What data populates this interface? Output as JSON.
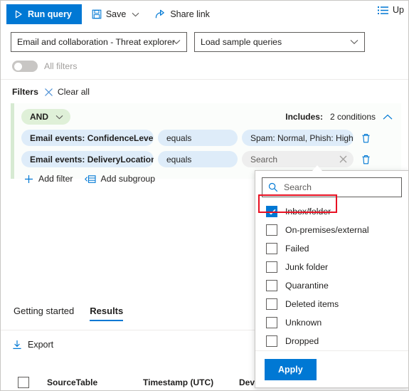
{
  "commandbar": {
    "run_query_label": "Run query",
    "save_label": "Save",
    "share_link_label": "Share link",
    "right_action_label": "Up"
  },
  "selectors": {
    "schema_value": "Email and collaboration - Threat explorer",
    "sample_queries_value": "Load sample queries"
  },
  "all_filters": {
    "label": "All filters",
    "state": "off"
  },
  "filters_header": {
    "title": "Filters",
    "clear_all_label": "Clear all"
  },
  "filter_group": {
    "operator_label": "AND",
    "includes_prefix": "Includes:",
    "includes_value": "2 conditions",
    "conditions": [
      {
        "field": "Email events: ConfidenceLevel",
        "operator": "equals",
        "value": "Spam: Normal, Phish: High",
        "value_empty": false
      },
      {
        "field": "Email events: DeliveryLocation",
        "operator": "equals",
        "value": "Search",
        "value_empty": true
      }
    ],
    "add_filter_label": "Add filter",
    "add_subgroup_label": "Add subgroup"
  },
  "value_dropdown": {
    "search_placeholder": "Search",
    "options": [
      {
        "label": "Inbox/folder",
        "checked": true
      },
      {
        "label": "On-premises/external",
        "checked": false
      },
      {
        "label": "Failed",
        "checked": false
      },
      {
        "label": "Junk folder",
        "checked": false
      },
      {
        "label": "Quarantine",
        "checked": false
      },
      {
        "label": "Deleted items",
        "checked": false
      },
      {
        "label": "Unknown",
        "checked": false
      },
      {
        "label": "Dropped",
        "checked": false
      }
    ],
    "apply_label": "Apply"
  },
  "tabs": [
    {
      "label": "Getting started",
      "active": false
    },
    {
      "label": "Results",
      "active": true
    }
  ],
  "results": {
    "export_label": "Export",
    "columns": [
      "SourceTable",
      "Timestamp (UTC)",
      "DeviceId"
    ]
  },
  "colors": {
    "accent": "#0078d4",
    "group_green": "#dff0d8",
    "pill_blue": "#deecf9",
    "highlight_red": "#e81123"
  }
}
